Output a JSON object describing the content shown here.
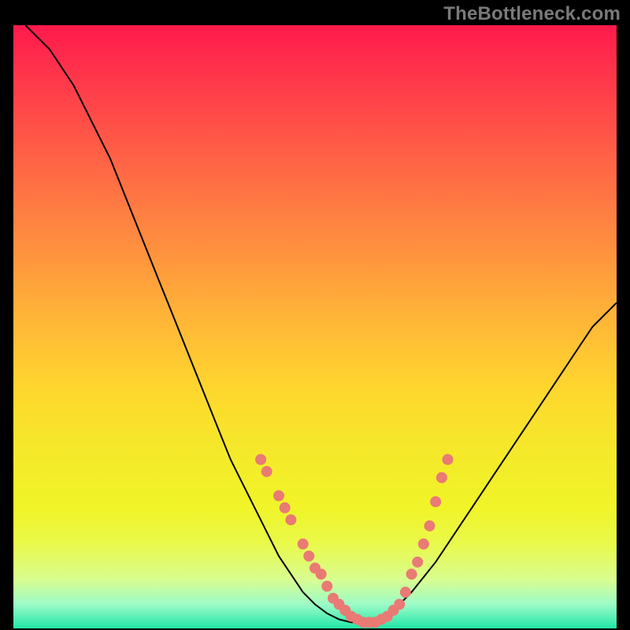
{
  "watermark": "TheBottleneck.com",
  "colors": {
    "marker": "#e97a74",
    "curve": "#000000",
    "gradient_top": "#ff1a4d",
    "gradient_bottom": "#22e6a8"
  },
  "chart_data": {
    "type": "line",
    "title": "",
    "xlabel": "",
    "ylabel": "",
    "xlim": [
      0,
      100
    ],
    "ylim": [
      0,
      100
    ],
    "grid": false,
    "legend": false,
    "series": [
      {
        "name": "bottleneck-curve",
        "x": [
          2,
          4,
          6,
          8,
          10,
          12,
          14,
          16,
          18,
          20,
          22,
          24,
          26,
          28,
          30,
          32,
          34,
          36,
          38,
          40,
          42,
          44,
          46,
          48,
          50,
          52,
          54,
          56,
          58,
          60,
          62,
          64,
          66,
          68,
          70,
          72,
          74,
          76,
          78,
          80,
          82,
          84,
          86,
          88,
          90,
          92,
          94,
          96,
          98,
          100
        ],
        "y": [
          100,
          98,
          96,
          93,
          90,
          86,
          82,
          78,
          73,
          68,
          63,
          58,
          53,
          48,
          43,
          38,
          33,
          28,
          24,
          20,
          16,
          12,
          9,
          6,
          4,
          2.5,
          1.5,
          1,
          1,
          1.5,
          2.5,
          4,
          6,
          8.5,
          11,
          14,
          17,
          20,
          23,
          26,
          29,
          32,
          35,
          38,
          41,
          44,
          47,
          50,
          52,
          54
        ]
      }
    ],
    "markers": {
      "name": "highlighted-points",
      "points": [
        {
          "x": 41,
          "y": 28
        },
        {
          "x": 42,
          "y": 26
        },
        {
          "x": 44,
          "y": 22
        },
        {
          "x": 45,
          "y": 20
        },
        {
          "x": 46,
          "y": 18
        },
        {
          "x": 48,
          "y": 14
        },
        {
          "x": 49,
          "y": 12
        },
        {
          "x": 50,
          "y": 10
        },
        {
          "x": 51,
          "y": 9
        },
        {
          "x": 52,
          "y": 7
        },
        {
          "x": 53,
          "y": 5
        },
        {
          "x": 54,
          "y": 4
        },
        {
          "x": 55,
          "y": 3
        },
        {
          "x": 56,
          "y": 2
        },
        {
          "x": 57,
          "y": 1.5
        },
        {
          "x": 58,
          "y": 1
        },
        {
          "x": 59,
          "y": 1
        },
        {
          "x": 60,
          "y": 1
        },
        {
          "x": 61,
          "y": 1.5
        },
        {
          "x": 62,
          "y": 2
        },
        {
          "x": 63,
          "y": 3
        },
        {
          "x": 64,
          "y": 4
        },
        {
          "x": 65,
          "y": 6
        },
        {
          "x": 66,
          "y": 9
        },
        {
          "x": 67,
          "y": 11
        },
        {
          "x": 68,
          "y": 14
        },
        {
          "x": 69,
          "y": 17
        },
        {
          "x": 70,
          "y": 21
        },
        {
          "x": 71,
          "y": 25
        },
        {
          "x": 72,
          "y": 28
        }
      ]
    }
  }
}
